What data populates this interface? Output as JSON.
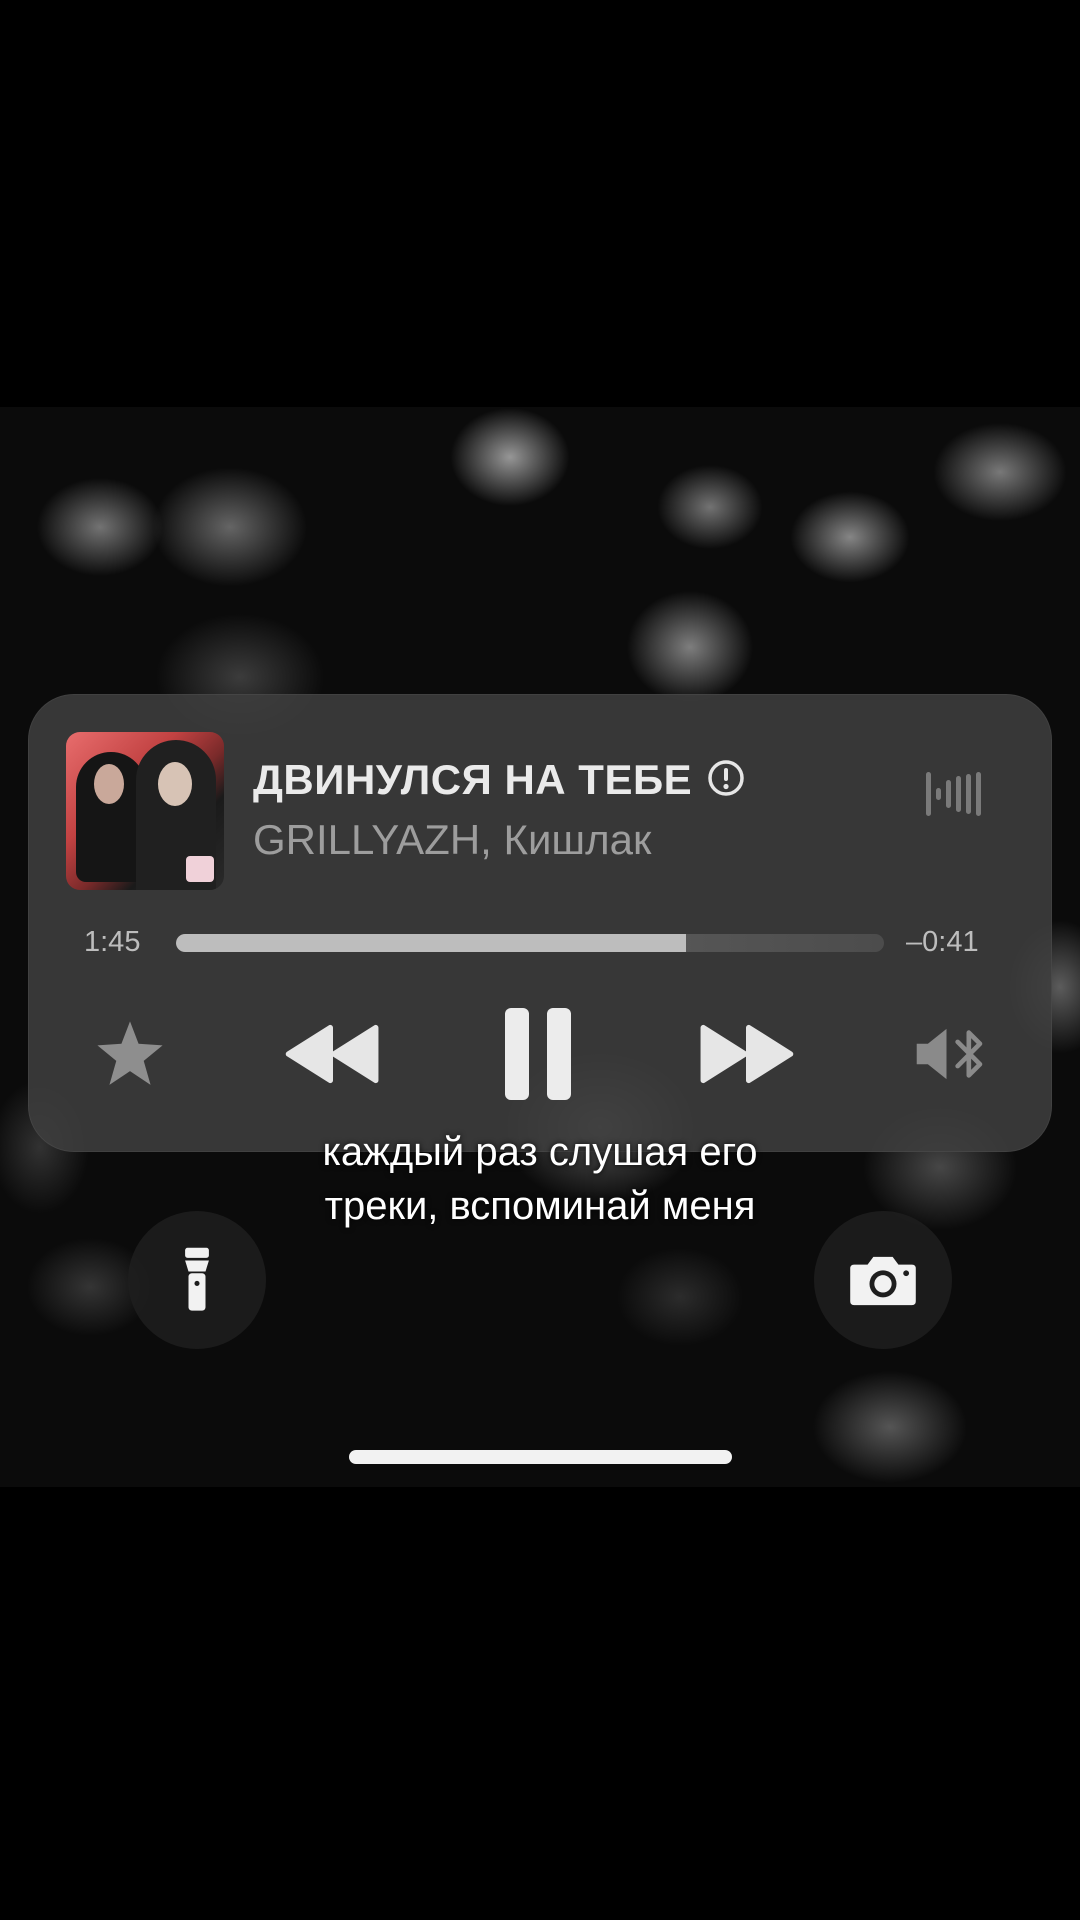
{
  "now_playing": {
    "title": "ДВИНУЛСЯ НА ТЕБЕ",
    "explicit_icon": "explicit-icon",
    "artist": "GRILLYAZH, Кишлак",
    "elapsed": "1:45",
    "remaining": "–0:41",
    "progress": 0.72,
    "airplay_icon": "audio-waveform-icon"
  },
  "controls": {
    "star_icon": "star-icon",
    "rewind_icon": "rewind-icon",
    "pause_icon": "pause-icon",
    "forward_icon": "fast-forward-icon",
    "audio_route_icon": "speaker-bluetooth-icon"
  },
  "caption": {
    "line1": "каждый раз слушая его",
    "line2": "треки, вспоминай меня"
  },
  "lockscreen": {
    "flashlight_icon": "flashlight-icon",
    "camera_icon": "camera-icon"
  },
  "colors": {
    "widget_bg": "#3e3e3e",
    "title": "#eaeaea",
    "artist": "#9d9d9d",
    "progress_fill": "#bdbdbd"
  }
}
